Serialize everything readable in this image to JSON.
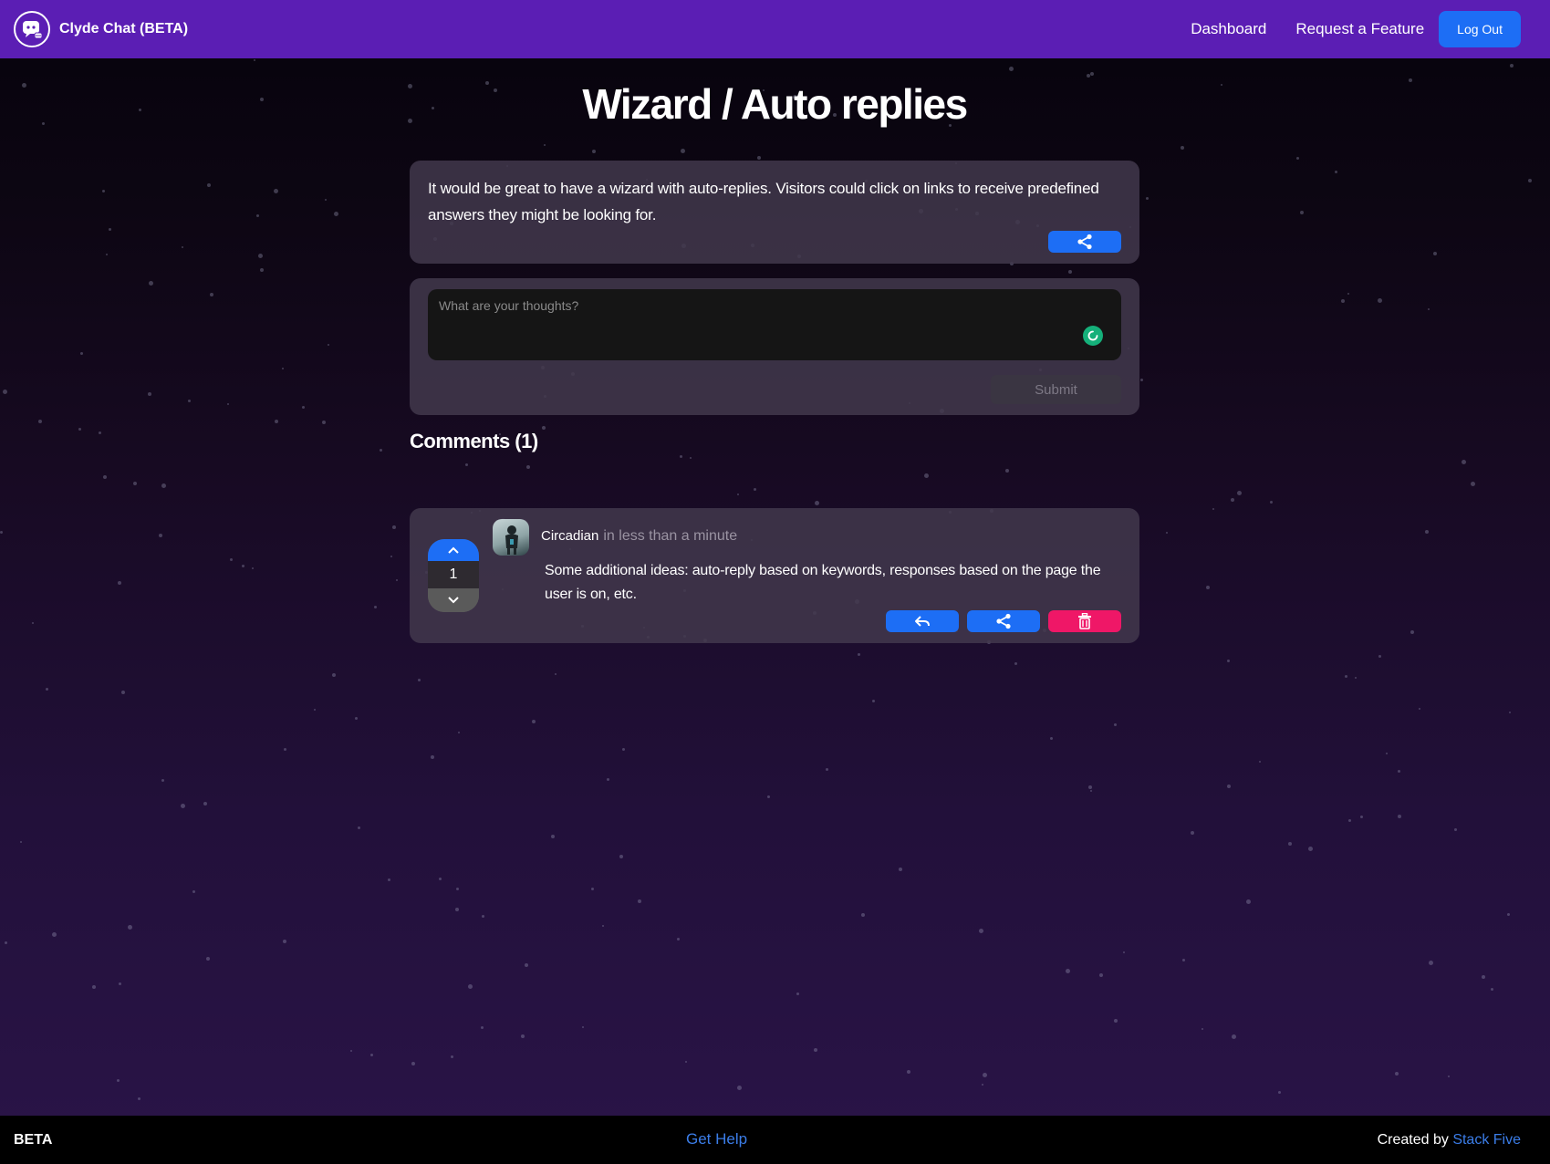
{
  "header": {
    "brand_name": "Clyde Chat (BETA)",
    "nav": {
      "dashboard": "Dashboard",
      "request_feature": "Request a Feature",
      "logout": "Log Out"
    }
  },
  "feature": {
    "title": "Wizard / Auto replies",
    "description": "It would be great to have a wizard with auto-replies. Visitors could click on links to receive predefined answers they might be looking for."
  },
  "comment_form": {
    "placeholder": "What are your thoughts?",
    "submit_label": "Submit"
  },
  "comments": {
    "heading": "Comments (1)",
    "items": [
      {
        "author": "Circadian",
        "time": "in less than a minute",
        "votes": "1",
        "body": "Some additional ideas: auto-reply based on keywords, responses based on the page the user is on, etc."
      }
    ]
  },
  "footer": {
    "beta": "BETA",
    "help": "Get Help",
    "credit_prefix": "Created by",
    "credit_link": "Stack Five"
  },
  "colors": {
    "brand": "#5b1eb4",
    "primary": "#1d6ef5",
    "danger": "#ef1767",
    "link": "#3b7de8"
  }
}
